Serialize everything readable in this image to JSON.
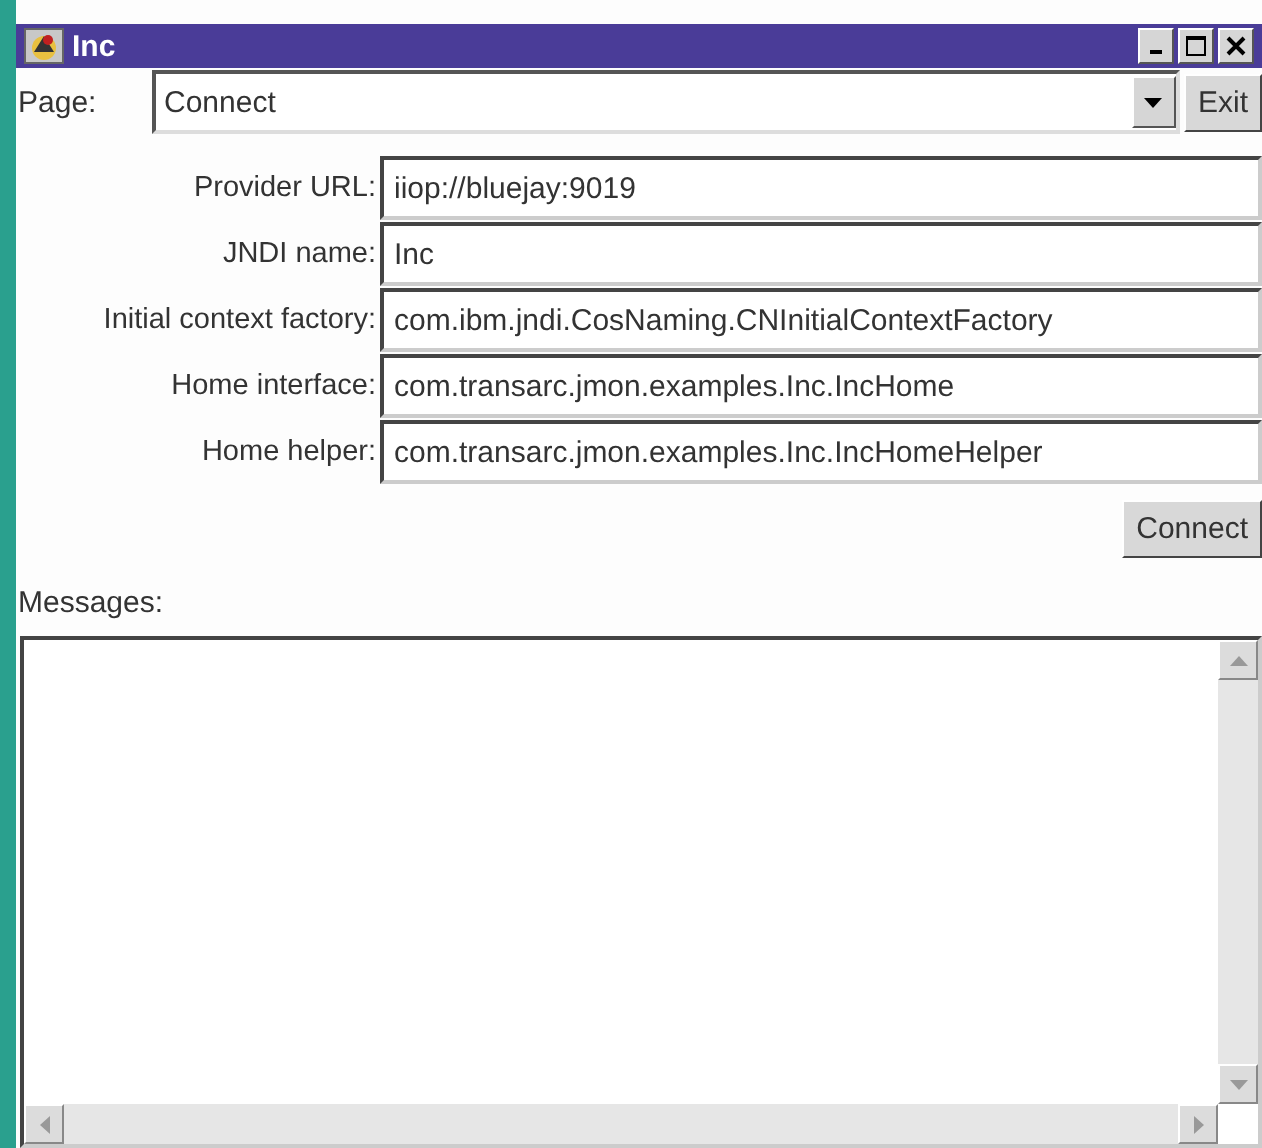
{
  "window": {
    "title": "Inc"
  },
  "page_selector": {
    "label": "Page:",
    "value": "Connect"
  },
  "exit_button": "Exit",
  "fields": [
    {
      "label": "Provider URL:",
      "value": "iiop://bluejay:9019"
    },
    {
      "label": "JNDI name:",
      "value": "Inc"
    },
    {
      "label": "Initial context factory:",
      "value": "com.ibm.jndi.CosNaming.CNInitialContextFactory"
    },
    {
      "label": "Home interface:",
      "value": "com.transarc.jmon.examples.Inc.IncHome"
    },
    {
      "label": "Home helper:",
      "value": "com.transarc.jmon.examples.Inc.IncHomeHelper"
    }
  ],
  "connect_button": "Connect",
  "messages": {
    "label": "Messages:"
  }
}
